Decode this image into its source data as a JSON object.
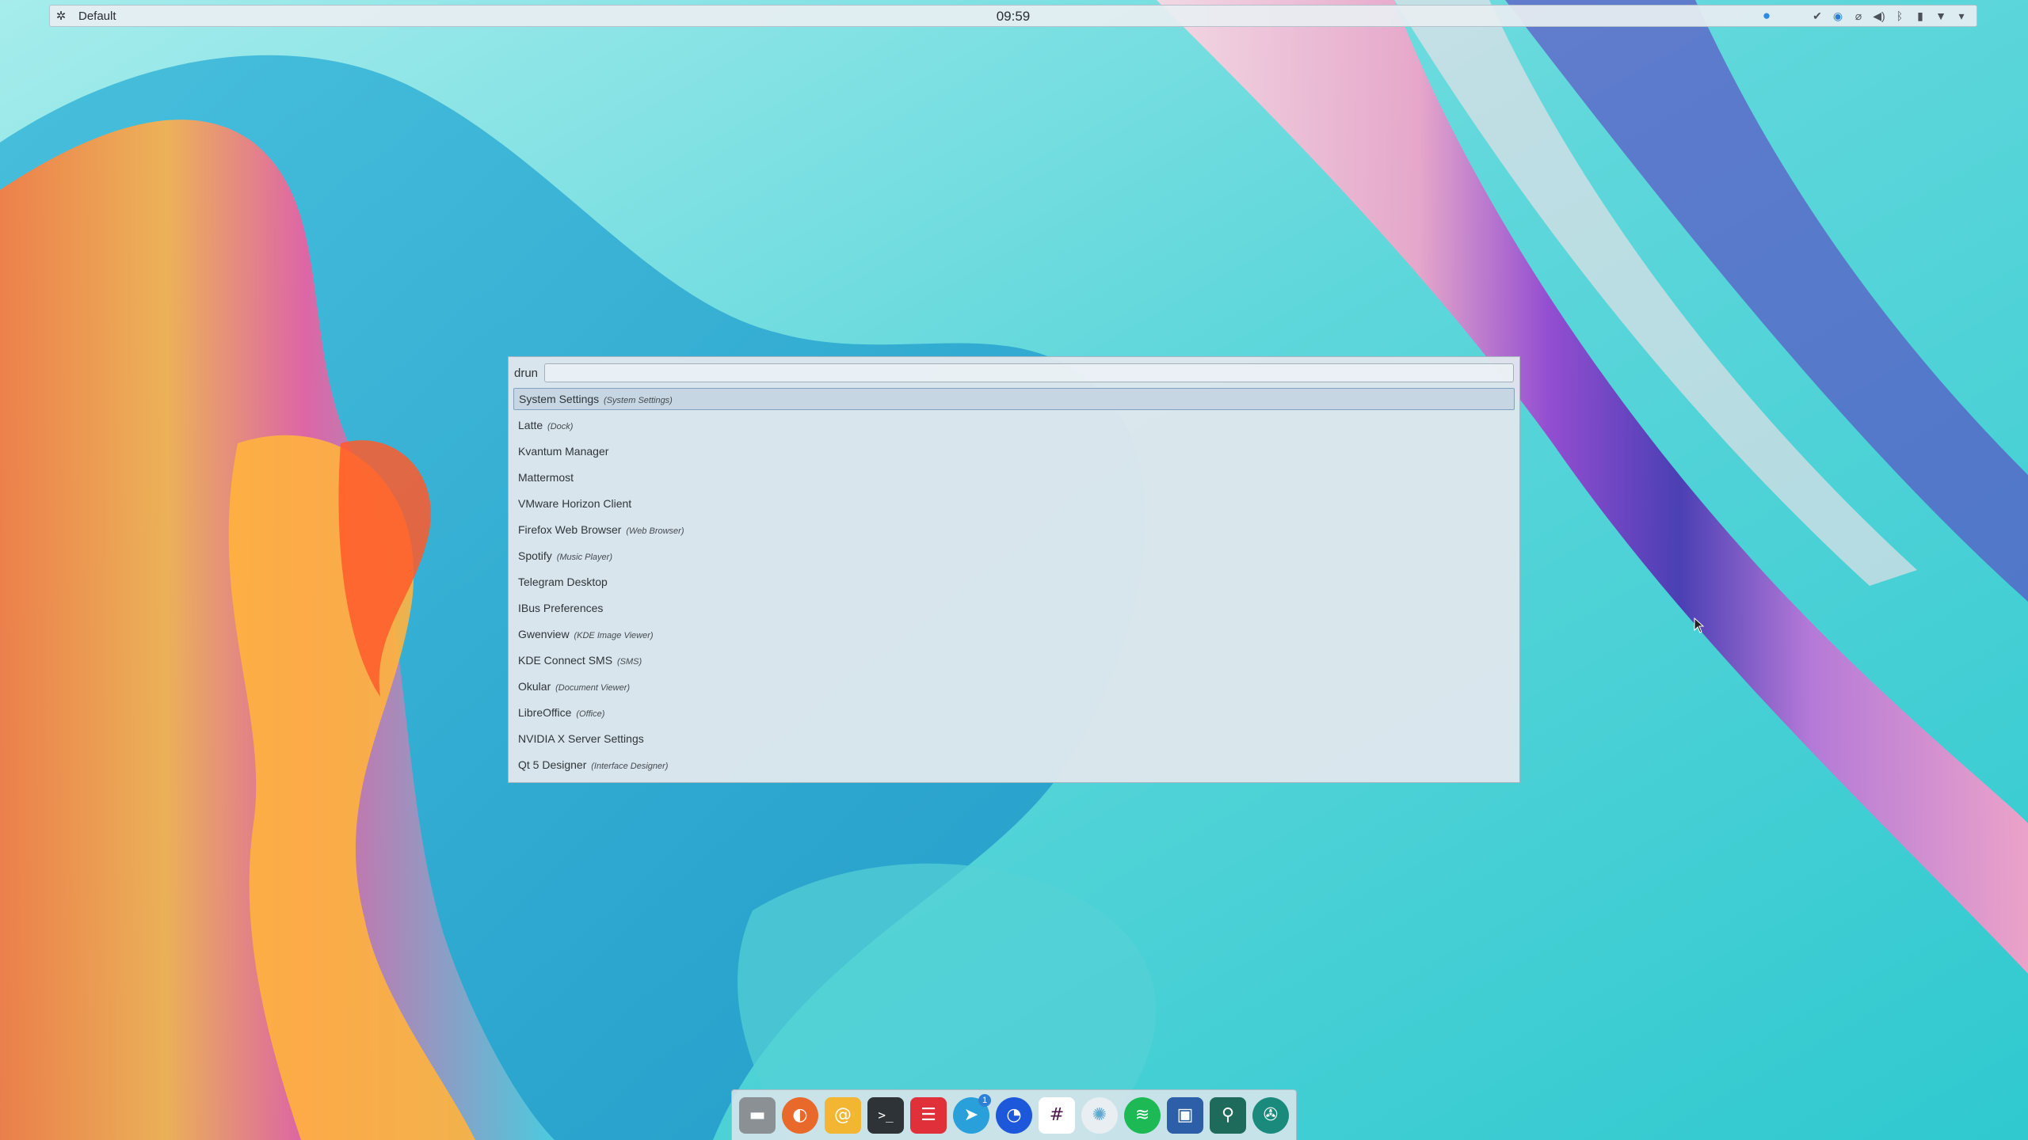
{
  "panel": {
    "activity": "Default",
    "clock": "09:59",
    "tray_icons": [
      "info-icon",
      "check-icon",
      "globe-icon",
      "paperclip-icon",
      "volume-icon",
      "bluetooth-icon",
      "battery-icon",
      "wifi-icon",
      "expand-tray-icon"
    ]
  },
  "run_dialog": {
    "mode": "drun",
    "input_value": "",
    "items": [
      {
        "name": "System Settings",
        "generic": "(System Settings)",
        "selected": true
      },
      {
        "name": "Latte",
        "generic": "(Dock)"
      },
      {
        "name": "Kvantum Manager",
        "generic": ""
      },
      {
        "name": "Mattermost",
        "generic": ""
      },
      {
        "name": "VMware Horizon Client",
        "generic": ""
      },
      {
        "name": "Firefox Web Browser",
        "generic": "(Web Browser)"
      },
      {
        "name": "Spotify",
        "generic": "(Music Player)"
      },
      {
        "name": "Telegram Desktop",
        "generic": ""
      },
      {
        "name": "IBus Preferences",
        "generic": ""
      },
      {
        "name": "Gwenview",
        "generic": "(KDE Image Viewer)"
      },
      {
        "name": "KDE Connect SMS",
        "generic": "(SMS)"
      },
      {
        "name": "Okular",
        "generic": "(Document Viewer)"
      },
      {
        "name": "LibreOffice",
        "generic": "(Office)"
      },
      {
        "name": "NVIDIA X Server Settings",
        "generic": ""
      },
      {
        "name": "Qt 5 Designer",
        "generic": "(Interface Designer)"
      }
    ]
  },
  "dock": {
    "apps": [
      {
        "name": "files",
        "icon": "folder-icon",
        "color": "#8b9095"
      },
      {
        "name": "firefox",
        "icon": "firefox-icon",
        "color": "#e8692a"
      },
      {
        "name": "mail",
        "icon": "mail-icon",
        "color": "#f2b632"
      },
      {
        "name": "terminal",
        "icon": "terminal-icon",
        "color": "#2e3338"
      },
      {
        "name": "tasks",
        "icon": "checklist-icon",
        "color": "#e0303a"
      },
      {
        "name": "telegram",
        "icon": "telegram-icon",
        "color": "#2aa0db",
        "badge": "1"
      },
      {
        "name": "mattermost",
        "icon": "mattermost-icon",
        "color": "#1c58d9"
      },
      {
        "name": "slack",
        "icon": "slack-icon",
        "color": "#ffffff"
      },
      {
        "name": "coral",
        "icon": "coral-icon",
        "color": "#e8eef2"
      },
      {
        "name": "spotify",
        "icon": "spotify-icon",
        "color": "#1db954"
      },
      {
        "name": "vmware",
        "icon": "vmware-icon",
        "color": "#2d5fa8"
      },
      {
        "name": "kvantum",
        "icon": "kvantum-icon",
        "color": "#1e6b5c"
      },
      {
        "name": "camera",
        "icon": "aperture-icon",
        "color": "#1a8a7d"
      }
    ]
  }
}
